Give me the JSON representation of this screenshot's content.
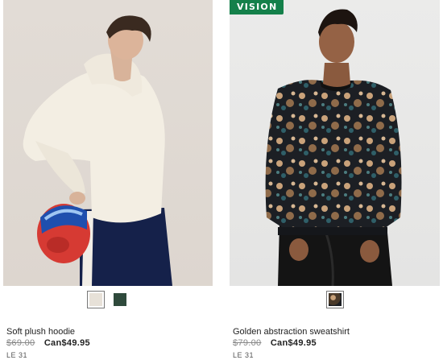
{
  "products": [
    {
      "name": "Soft plush hoodie",
      "old_price": "$69.00",
      "new_price": "Can$49.95",
      "tag": "LE 31",
      "image_icon": "model-in-white-plush-hoodie-holding-red-helmet",
      "badge": null,
      "swatches": [
        {
          "color": "#e7e1d8",
          "selected": true
        },
        {
          "color": "#2f4a3c",
          "selected": false
        }
      ]
    },
    {
      "name": "Golden abstraction sweatshirt",
      "old_price": "$79.00",
      "new_price": "Can$49.95",
      "tag": "LE 31",
      "image_icon": "model-in-gold-floral-sweatshirt-and-black-pants",
      "badge": "VISION",
      "swatches": [
        {
          "color": "#4a3a2a",
          "selected": true
        }
      ]
    }
  ],
  "colors": {
    "badge_green": "#14804a",
    "text": "#222222",
    "old_price_gray": "#888888"
  }
}
